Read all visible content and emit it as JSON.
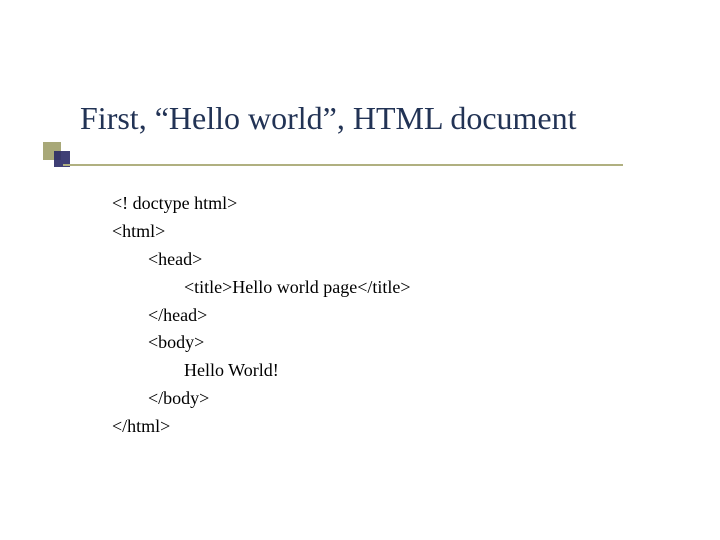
{
  "slide": {
    "title": "First, “Hello world”, HTML document"
  },
  "code": {
    "lines": [
      {
        "indent": 0,
        "text": "<! doctype html>"
      },
      {
        "indent": 0,
        "text": "<html>"
      },
      {
        "indent": 1,
        "text": "<head>"
      },
      {
        "indent": 2,
        "text": "<title>Hello world page</title>"
      },
      {
        "indent": 1,
        "text": "</head>"
      },
      {
        "indent": 1,
        "text": "<body>"
      },
      {
        "indent": 2,
        "text": "Hello World!"
      },
      {
        "indent": 1,
        "text": "</body>"
      },
      {
        "indent": 0,
        "text": "</html>"
      }
    ]
  }
}
